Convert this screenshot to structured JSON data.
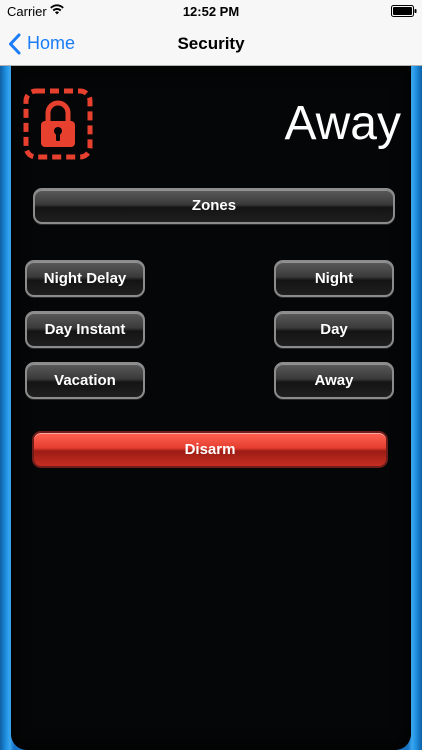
{
  "status_bar": {
    "carrier": "Carrier",
    "time": "12:52 PM",
    "wifi_icon": "wifi-icon",
    "battery_icon": "battery-icon"
  },
  "nav": {
    "back_label": "Home",
    "back_icon": "chevron-left-icon",
    "title": "Security",
    "tint_color": "#1a7cf7"
  },
  "security": {
    "mode": "Away",
    "lock_icon": "lock-icon",
    "lock_color": "#e8402e",
    "buttons": {
      "zones": "Zones",
      "night_delay": "Night Delay",
      "night": "Night",
      "day_instant": "Day Instant",
      "day": "Day",
      "vacation": "Vacation",
      "away": "Away",
      "disarm": "Disarm"
    }
  },
  "colors": {
    "panel_background": "#050607",
    "frame_blue": "#1f8fe0",
    "disarm_red": "#e63e30"
  }
}
